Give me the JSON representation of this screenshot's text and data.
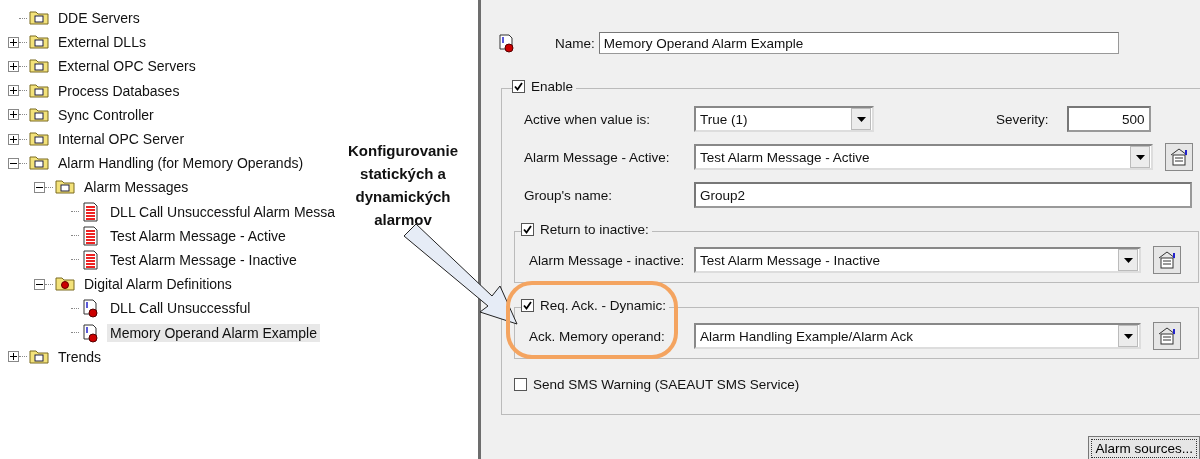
{
  "tree": [
    {
      "label": "DDE Servers",
      "kind": "folder",
      "selected": false
    },
    {
      "label": "External DLLs",
      "kind": "folder",
      "expanded": false,
      "selected": false
    },
    {
      "label": "External OPC Servers",
      "kind": "folder",
      "expanded": false,
      "selected": false
    },
    {
      "label": "Process Databases",
      "kind": "folder",
      "expanded": false,
      "selected": false
    },
    {
      "label": "Sync Controller",
      "kind": "folder",
      "expanded": false,
      "selected": false
    },
    {
      "label": "Internal OPC Server",
      "kind": "folder",
      "expanded": false,
      "selected": false
    },
    {
      "label": "Alarm Handling (for Memory Operands)",
      "kind": "folder",
      "expanded": true,
      "selected": false,
      "children": [
        {
          "label": "Alarm Messages",
          "kind": "folder",
          "expanded": true,
          "selected": false,
          "children": [
            {
              "label": "DLL Call Unsuccessful Alarm Messa",
              "kind": "message",
              "selected": false
            },
            {
              "label": "Test Alarm Message - Active",
              "kind": "message",
              "selected": false
            },
            {
              "label": "Test Alarm Message - Inactive",
              "kind": "message",
              "selected": false
            }
          ]
        },
        {
          "label": "Digital Alarm Definitions",
          "kind": "alarm-folder",
          "expanded": true,
          "selected": false,
          "children": [
            {
              "label": "DLL Call Unsuccessful",
              "kind": "alarm",
              "selected": false
            },
            {
              "label": "Memory Operand Alarm Example",
              "kind": "alarm",
              "selected": true
            }
          ]
        }
      ]
    },
    {
      "label": "Trends",
      "kind": "folder",
      "expanded": false,
      "selected": false
    }
  ],
  "annotation": {
    "lines": [
      "Konfigurovanie",
      "statických a",
      "dynamických",
      "alarmov"
    ]
  },
  "form": {
    "name": {
      "label": "Name:",
      "value": "Memory Operand Alarm Example"
    },
    "enable": {
      "label": "Enable",
      "checked": true
    },
    "active_when": {
      "label": "Active when value is:",
      "value": "True (1)"
    },
    "severity": {
      "label": "Severity:",
      "value": "500"
    },
    "alarm_message_active": {
      "label": "Alarm Message - Active:",
      "value": "Test Alarm Message - Active"
    },
    "group_name": {
      "label": "Group's name:",
      "value": "Group2"
    },
    "return_to_inactive": {
      "label": "Return to inactive:",
      "checked": true,
      "message_label": "Alarm Message - inactive:",
      "message_value": "Test Alarm Message - Inactive"
    },
    "req_ack": {
      "label": "Req. Ack. - Dynamic:",
      "checked": true,
      "operand_label": "Ack. Memory operand:",
      "operand_value": "Alarm Handling Example/Alarm Ack"
    },
    "send_sms": {
      "label": "Send SMS Warning (SAEAUT SMS Service)",
      "checked": false
    },
    "alarm_sources_button": "Alarm sources..."
  }
}
